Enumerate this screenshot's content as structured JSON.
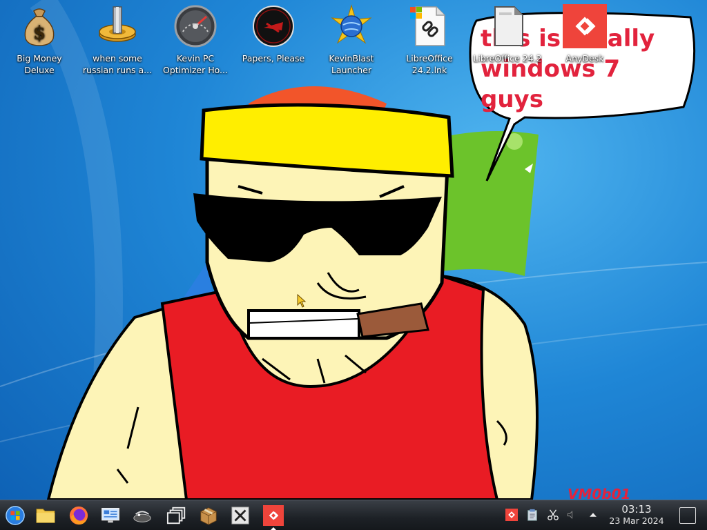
{
  "desktop": {
    "speech_bubble": {
      "line1": "this is totally",
      "line2": "windows 7 guys"
    },
    "watermark": "VM0b01",
    "icons": [
      {
        "label": "Big Money Deluxe",
        "icon": "money-bag-icon"
      },
      {
        "label": "when some russian runs a...",
        "icon": "gear-icon"
      },
      {
        "label": "Kevin PC Optimizer Ho...",
        "icon": "speedometer-icon"
      },
      {
        "label": "Papers, Please",
        "icon": "papers-please-icon"
      },
      {
        "label": "KevinBlast Launcher",
        "icon": "globe-star-icon"
      },
      {
        "label": "LibreOffice 24.2.lnk",
        "icon": "shortcut-file-icon"
      },
      {
        "label": "LibreOffice 24.2",
        "icon": "libreoffice-icon"
      },
      {
        "label": "AnyDesk",
        "icon": "anydesk-icon"
      }
    ]
  },
  "taskbar": {
    "pinned": [
      {
        "name": "start-button",
        "icon": "start-orb-icon"
      },
      {
        "name": "file-manager",
        "icon": "folder-icon"
      },
      {
        "name": "firefox",
        "icon": "firefox-icon"
      },
      {
        "name": "system-monitor",
        "icon": "monitor-icon"
      },
      {
        "name": "wine",
        "icon": "wine-glass-icon"
      },
      {
        "name": "task-switcher",
        "icon": "windows-stack-icon"
      },
      {
        "name": "archive-manager",
        "icon": "package-icon"
      },
      {
        "name": "xorg-app",
        "icon": "x-icon"
      },
      {
        "name": "anydesk",
        "icon": "anydesk-icon"
      }
    ],
    "tray": {
      "items": [
        "anydesk-tray-icon",
        "clipboard-icon",
        "scissors-icon",
        "volume-icon",
        "expand-tray-icon"
      ]
    },
    "clock": {
      "time": "03:13",
      "date": "23 Mar 2024"
    }
  },
  "colors": {
    "desktop_blue": "#1f86d6",
    "bubble_text": "#e2233d",
    "anydesk_red": "#ef443b",
    "taskbar": "#1d2126"
  }
}
